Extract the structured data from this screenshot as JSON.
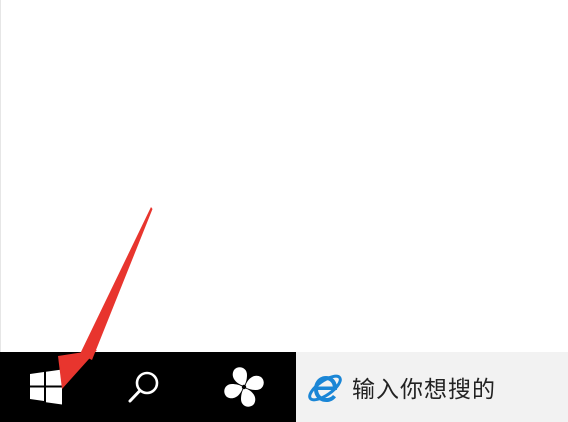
{
  "taskbar": {
    "start_icon": "windows-logo-icon",
    "search_icon": "search-icon",
    "cortana_icon": "cortana-icon",
    "search_box": {
      "browser_icon": "internet-explorer-icon",
      "placeholder": "输入你想搜的"
    }
  },
  "annotation": {
    "type": "arrow",
    "color": "#e8352e",
    "points_to": "start-button"
  },
  "colors": {
    "taskbar": "#000000",
    "search_box": "#f2f2f2",
    "ie_blue": "#1a86d6"
  }
}
